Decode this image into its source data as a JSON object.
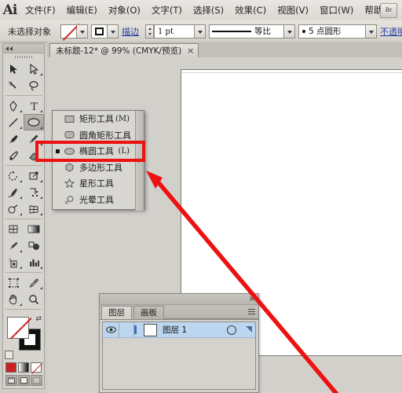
{
  "app": {
    "name": "Ai",
    "logo_text": "Ai",
    "bridge_button": "Br"
  },
  "menubar": {
    "items": [
      {
        "label": "文件(F)",
        "name": "menu-file"
      },
      {
        "label": "编辑(E)",
        "name": "menu-edit"
      },
      {
        "label": "对象(O)",
        "name": "menu-object"
      },
      {
        "label": "文字(T)",
        "name": "menu-type"
      },
      {
        "label": "选择(S)",
        "name": "menu-select"
      },
      {
        "label": "效果(C)",
        "name": "menu-effect"
      },
      {
        "label": "视图(V)",
        "name": "menu-view"
      },
      {
        "label": "窗口(W)",
        "name": "menu-window"
      },
      {
        "label": "帮助(H)",
        "name": "menu-help"
      }
    ]
  },
  "controlbar": {
    "selection_status": "未选择对象",
    "fill_label": "填色",
    "stroke_swatch_label": "描边颜色",
    "stroke_link": "描边",
    "stroke_weight": "1 pt",
    "brush_definition": "等比",
    "stroke_profile": "5 点圆形",
    "opacity_link": "不透明度"
  },
  "tabstrip": {
    "document_tab": "未标题-12* @ 99% (CMYK/预览)",
    "close_glyph": "×"
  },
  "toolbox": {
    "tools": [
      {
        "label": "选择工具",
        "icon": "selection-arrow-icon",
        "flyout": false,
        "selected": false
      },
      {
        "label": "直接选择工具",
        "icon": "direct-selection-arrow-icon",
        "flyout": true,
        "selected": false
      },
      {
        "label": "魔棒工具",
        "icon": "magic-wand-icon",
        "flyout": false,
        "selected": false
      },
      {
        "label": "套索工具",
        "icon": "lasso-icon",
        "flyout": false,
        "selected": false
      },
      {
        "label": "钢笔工具",
        "icon": "pen-icon",
        "flyout": true,
        "selected": false
      },
      {
        "label": "文字工具",
        "icon": "type-icon",
        "flyout": true,
        "selected": false
      },
      {
        "label": "直线段工具",
        "icon": "line-segment-icon",
        "flyout": true,
        "selected": false
      },
      {
        "label": "椭圆工具",
        "icon": "ellipse-icon",
        "flyout": true,
        "selected": true
      },
      {
        "label": "画笔工具",
        "icon": "paintbrush-icon",
        "flyout": false,
        "selected": false
      },
      {
        "label": "铅笔工具",
        "icon": "pencil-icon",
        "flyout": true,
        "selected": false
      },
      {
        "label": "斑点画笔工具",
        "icon": "blob-brush-icon",
        "flyout": false,
        "selected": false
      },
      {
        "label": "橡皮擦工具",
        "icon": "eraser-icon",
        "flyout": true,
        "selected": false
      },
      {
        "label": "旋转工具",
        "icon": "rotate-icon",
        "flyout": true,
        "selected": false
      },
      {
        "label": "比例缩放工具",
        "icon": "scale-icon",
        "flyout": true,
        "selected": false
      },
      {
        "label": "变形工具",
        "icon": "warp-icon",
        "flyout": true,
        "selected": false
      },
      {
        "label": "自由变换工具",
        "icon": "free-transform-icon",
        "flyout": true,
        "selected": false
      },
      {
        "label": "形状生成器工具",
        "icon": "shape-builder-icon",
        "flyout": true,
        "selected": false
      },
      {
        "label": "透视网格工具",
        "icon": "perspective-grid-icon",
        "flyout": true,
        "selected": false
      },
      {
        "label": "网格工具",
        "icon": "mesh-icon",
        "flyout": false,
        "selected": false
      },
      {
        "label": "渐变工具",
        "icon": "gradient-icon",
        "flyout": false,
        "selected": false
      },
      {
        "label": "吸管工具",
        "icon": "eyedropper-icon",
        "flyout": true,
        "selected": false
      },
      {
        "label": "混合工具",
        "icon": "blend-icon",
        "flyout": false,
        "selected": false
      },
      {
        "label": "符号喷枪工具",
        "icon": "symbol-sprayer-icon",
        "flyout": true,
        "selected": false
      },
      {
        "label": "柱形图工具",
        "icon": "column-graph-icon",
        "flyout": true,
        "selected": false
      },
      {
        "label": "画板工具",
        "icon": "artboard-icon",
        "flyout": false,
        "selected": false
      },
      {
        "label": "切片工具",
        "icon": "slice-icon",
        "flyout": true,
        "selected": false
      },
      {
        "label": "抓手工具",
        "icon": "hand-icon",
        "flyout": true,
        "selected": false
      },
      {
        "label": "缩放工具",
        "icon": "zoom-icon",
        "flyout": false,
        "selected": false
      }
    ],
    "fill_label": "填色",
    "stroke_label": "描边",
    "color_modes": [
      "颜色",
      "渐变",
      "无"
    ],
    "screen_modes": [
      "正常屏幕模式",
      "带有菜单栏的全屏模式",
      "全屏模式"
    ]
  },
  "flyout": {
    "items": [
      {
        "label": "矩形工具",
        "shortcut": "(M)",
        "icon": "rectangle-icon",
        "selected": false
      },
      {
        "label": "圆角矩形工具",
        "shortcut": "",
        "icon": "rounded-rectangle-icon",
        "selected": false
      },
      {
        "label": "椭圆工具",
        "shortcut": "(L)",
        "icon": "ellipse-icon",
        "selected": true
      },
      {
        "label": "多边形工具",
        "shortcut": "",
        "icon": "polygon-icon",
        "selected": false
      },
      {
        "label": "星形工具",
        "shortcut": "",
        "icon": "star-icon",
        "selected": false
      },
      {
        "label": "光晕工具",
        "shortcut": "",
        "icon": "flare-icon",
        "selected": false
      }
    ]
  },
  "layers_panel": {
    "tabs": [
      {
        "label": "图层",
        "active": true
      },
      {
        "label": "画板",
        "active": false
      }
    ],
    "close_glyph": "×",
    "rows": [
      {
        "name": "图层 1",
        "visible": true,
        "locked": false,
        "selected": true
      }
    ]
  },
  "annotations": {
    "highlight_color": "#ee1111",
    "arrow_color": "#ee1111",
    "arrow_from": "430,500",
    "arrow_to": "188,219"
  }
}
